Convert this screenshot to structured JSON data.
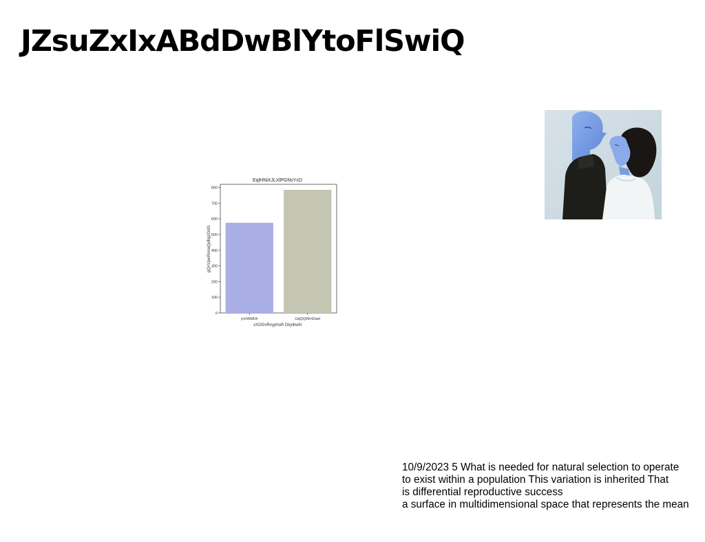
{
  "slide": {
    "title": "JZsuZxIxABdDwBlYtoFlSwiQ"
  },
  "chart_data": {
    "type": "bar",
    "title": "EqlHNiXJLXlPGNsYcD",
    "xlabel": "xXOGvRnyphoR DkyIbwN",
    "ylabel": "gQxVjaeRnnaQylhgzGdG",
    "categories": [
      "yrUWbKih",
      "UqQQWmDael"
    ],
    "values": [
      575,
      785
    ],
    "ylim": [
      0,
      820
    ],
    "yticks": [
      "0",
      "100",
      "200",
      "300",
      "400",
      "500",
      "600",
      "700",
      "800"
    ],
    "colors": [
      "#a9aee5",
      "#c4c5b3"
    ],
    "grid": false
  },
  "photo": {
    "subject": "two-people-portrait",
    "palette": [
      "#cfdde4",
      "#7f9de0",
      "#1e1e1c",
      "#f2f6f7"
    ]
  },
  "body": {
    "lines": [
      "10/9/2023 5 What is needed for natural selection to operate",
      "to exist within a population This variation is inherited That",
      "is differential reproductive success",
      "a surface in multidimensional space that represents the mean"
    ]
  }
}
